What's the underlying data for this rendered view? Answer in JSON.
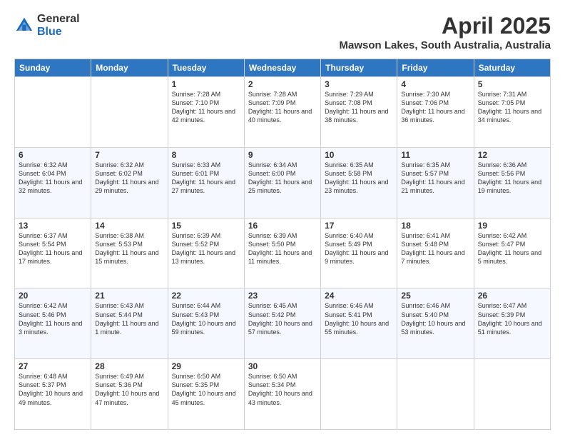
{
  "header": {
    "logo_general": "General",
    "logo_blue": "Blue",
    "month": "April 2025",
    "location": "Mawson Lakes, South Australia, Australia"
  },
  "days_of_week": [
    "Sunday",
    "Monday",
    "Tuesday",
    "Wednesday",
    "Thursday",
    "Friday",
    "Saturday"
  ],
  "weeks": [
    [
      {
        "day": "",
        "text": ""
      },
      {
        "day": "",
        "text": ""
      },
      {
        "day": "1",
        "text": "Sunrise: 7:28 AM\nSunset: 7:10 PM\nDaylight: 11 hours and 42 minutes."
      },
      {
        "day": "2",
        "text": "Sunrise: 7:28 AM\nSunset: 7:09 PM\nDaylight: 11 hours and 40 minutes."
      },
      {
        "day": "3",
        "text": "Sunrise: 7:29 AM\nSunset: 7:08 PM\nDaylight: 11 hours and 38 minutes."
      },
      {
        "day": "4",
        "text": "Sunrise: 7:30 AM\nSunset: 7:06 PM\nDaylight: 11 hours and 36 minutes."
      },
      {
        "day": "5",
        "text": "Sunrise: 7:31 AM\nSunset: 7:05 PM\nDaylight: 11 hours and 34 minutes."
      }
    ],
    [
      {
        "day": "6",
        "text": "Sunrise: 6:32 AM\nSunset: 6:04 PM\nDaylight: 11 hours and 32 minutes."
      },
      {
        "day": "7",
        "text": "Sunrise: 6:32 AM\nSunset: 6:02 PM\nDaylight: 11 hours and 29 minutes."
      },
      {
        "day": "8",
        "text": "Sunrise: 6:33 AM\nSunset: 6:01 PM\nDaylight: 11 hours and 27 minutes."
      },
      {
        "day": "9",
        "text": "Sunrise: 6:34 AM\nSunset: 6:00 PM\nDaylight: 11 hours and 25 minutes."
      },
      {
        "day": "10",
        "text": "Sunrise: 6:35 AM\nSunset: 5:58 PM\nDaylight: 11 hours and 23 minutes."
      },
      {
        "day": "11",
        "text": "Sunrise: 6:35 AM\nSunset: 5:57 PM\nDaylight: 11 hours and 21 minutes."
      },
      {
        "day": "12",
        "text": "Sunrise: 6:36 AM\nSunset: 5:56 PM\nDaylight: 11 hours and 19 minutes."
      }
    ],
    [
      {
        "day": "13",
        "text": "Sunrise: 6:37 AM\nSunset: 5:54 PM\nDaylight: 11 hours and 17 minutes."
      },
      {
        "day": "14",
        "text": "Sunrise: 6:38 AM\nSunset: 5:53 PM\nDaylight: 11 hours and 15 minutes."
      },
      {
        "day": "15",
        "text": "Sunrise: 6:39 AM\nSunset: 5:52 PM\nDaylight: 11 hours and 13 minutes."
      },
      {
        "day": "16",
        "text": "Sunrise: 6:39 AM\nSunset: 5:50 PM\nDaylight: 11 hours and 11 minutes."
      },
      {
        "day": "17",
        "text": "Sunrise: 6:40 AM\nSunset: 5:49 PM\nDaylight: 11 hours and 9 minutes."
      },
      {
        "day": "18",
        "text": "Sunrise: 6:41 AM\nSunset: 5:48 PM\nDaylight: 11 hours and 7 minutes."
      },
      {
        "day": "19",
        "text": "Sunrise: 6:42 AM\nSunset: 5:47 PM\nDaylight: 11 hours and 5 minutes."
      }
    ],
    [
      {
        "day": "20",
        "text": "Sunrise: 6:42 AM\nSunset: 5:46 PM\nDaylight: 11 hours and 3 minutes."
      },
      {
        "day": "21",
        "text": "Sunrise: 6:43 AM\nSunset: 5:44 PM\nDaylight: 11 hours and 1 minute."
      },
      {
        "day": "22",
        "text": "Sunrise: 6:44 AM\nSunset: 5:43 PM\nDaylight: 10 hours and 59 minutes."
      },
      {
        "day": "23",
        "text": "Sunrise: 6:45 AM\nSunset: 5:42 PM\nDaylight: 10 hours and 57 minutes."
      },
      {
        "day": "24",
        "text": "Sunrise: 6:46 AM\nSunset: 5:41 PM\nDaylight: 10 hours and 55 minutes."
      },
      {
        "day": "25",
        "text": "Sunrise: 6:46 AM\nSunset: 5:40 PM\nDaylight: 10 hours and 53 minutes."
      },
      {
        "day": "26",
        "text": "Sunrise: 6:47 AM\nSunset: 5:39 PM\nDaylight: 10 hours and 51 minutes."
      }
    ],
    [
      {
        "day": "27",
        "text": "Sunrise: 6:48 AM\nSunset: 5:37 PM\nDaylight: 10 hours and 49 minutes."
      },
      {
        "day": "28",
        "text": "Sunrise: 6:49 AM\nSunset: 5:36 PM\nDaylight: 10 hours and 47 minutes."
      },
      {
        "day": "29",
        "text": "Sunrise: 6:50 AM\nSunset: 5:35 PM\nDaylight: 10 hours and 45 minutes."
      },
      {
        "day": "30",
        "text": "Sunrise: 6:50 AM\nSunset: 5:34 PM\nDaylight: 10 hours and 43 minutes."
      },
      {
        "day": "",
        "text": ""
      },
      {
        "day": "",
        "text": ""
      },
      {
        "day": "",
        "text": ""
      }
    ]
  ]
}
